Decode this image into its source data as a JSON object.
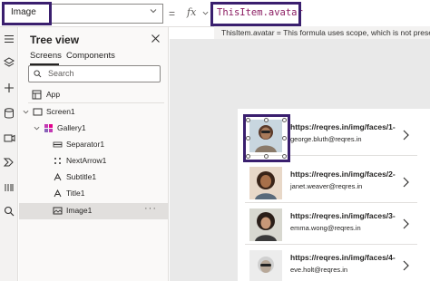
{
  "formula_bar": {
    "property": "Image",
    "equals": "=",
    "fx": "fx",
    "formula": "ThisItem.avatar",
    "hint": "ThisItem.avatar  =  This formula uses scope, which is not present"
  },
  "tree": {
    "title": "Tree view",
    "tabs": [
      "Screens",
      "Components"
    ],
    "search_placeholder": "Search",
    "app_label": "App",
    "nodes": [
      "Screen1",
      "Gallery1",
      "Separator1",
      "NextArrow1",
      "Subtitle1",
      "Title1",
      "Image1"
    ],
    "more": "···"
  },
  "gallery": {
    "items": [
      {
        "title": "https://reqres.in/img/faces/1-",
        "subtitle": "george.bluth@reqres.in"
      },
      {
        "title": "https://reqres.in/img/faces/2-",
        "subtitle": "janet.weaver@reqres.in"
      },
      {
        "title": "https://reqres.in/img/faces/3-",
        "subtitle": "emma.wong@reqres.in"
      },
      {
        "title": "https://reqres.in/img/faces/4-",
        "subtitle": "eve.holt@reqres.in"
      }
    ]
  },
  "colors": {
    "accent": "#3a1f6e",
    "formula_text": "#8b1c62",
    "canvas": "#e9e9e9"
  }
}
